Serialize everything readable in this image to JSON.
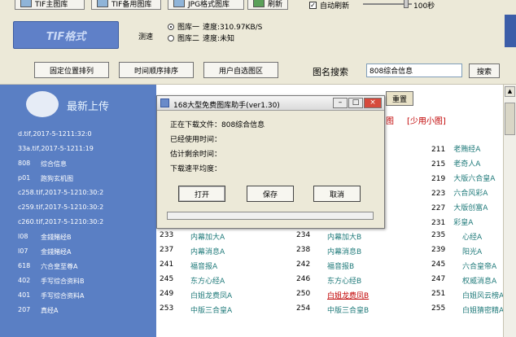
{
  "toolbar": {
    "tif_main": "TIF主图库",
    "tif_backup": "TIF备用图库",
    "jpg": "JPG格式图库",
    "refresh": "刷新",
    "auto_refresh": "自动刷新",
    "interval": "100秒"
  },
  "header": {
    "logo_text": "TIF格式",
    "speed_test_label": "测速",
    "lib1_label": "图库一",
    "lib1_speed": "速度:310.97KB/S",
    "lib2_label": "图库二",
    "lib2_speed": "速度:未知"
  },
  "buttons": {
    "fixed_order": "固定位置排列",
    "time_order": "时间顺序排序",
    "user_custom": "用户自选图区",
    "search_label": "图名搜索",
    "search_value": "808综合信息",
    "search_btn": "搜索"
  },
  "left": {
    "title": "最新上传",
    "items": [
      {
        "code": "d.tif,2017-5-1211:32:0",
        "name": ""
      },
      {
        "code": "33a.tif,2017-5-1211:19",
        "name": ""
      },
      {
        "code": "808",
        "name": "综合信息"
      },
      {
        "code": "p01",
        "name": "跑狗玄机图"
      },
      {
        "code": "c258.tif,2017-5-1210:30:2",
        "name": ""
      },
      {
        "code": "c259.tif,2017-5-1210:30:2",
        "name": ""
      },
      {
        "code": "c260.tif,2017-5-1210:30:2",
        "name": ""
      },
      {
        "code": "l08",
        "name": "金錢賭经B"
      },
      {
        "code": "l07",
        "name": "金錢賭经A"
      },
      {
        "code": "618",
        "name": "六合皇至尊A"
      },
      {
        "code": "402",
        "name": "手写综合资料B"
      },
      {
        "code": "401",
        "name": "手写综合资料A"
      },
      {
        "code": "207",
        "name": "真经A"
      }
    ]
  },
  "right": {
    "reset": "重置",
    "header_fragment": "图",
    "small_pic": "[少用小图]",
    "rows": [
      {
        "n1": "233",
        "t1": "内幕加大A",
        "n2": "234",
        "t2": "内幕加大B",
        "n3": "235",
        "t3": "心经A"
      },
      {
        "n1": "237",
        "t1": "内幕消息A",
        "n2": "238",
        "t2": "内幕消息B",
        "n3": "239",
        "t3": "阳光A"
      },
      {
        "n1": "241",
        "t1": "福音报A",
        "n2": "242",
        "t2": "福音报B",
        "n3": "245",
        "t3": "六合皇帝A"
      },
      {
        "n1": "245",
        "t1": "东方心经A",
        "n2": "246",
        "t2": "东方心经B",
        "n3": "247",
        "t3": "权威消息A"
      },
      {
        "n1": "249",
        "t1": "白姐龙费凤A",
        "n2": "250",
        "t2": "白姐龙费凤B",
        "n3": "251",
        "t3": "白姐风云榜A"
      },
      {
        "n1": "253",
        "t1": "中版三合皇A",
        "n2": "254",
        "t2": "中版三合皇B",
        "n3": "255",
        "t3": "白姐猜密精A"
      }
    ],
    "top_col": [
      {
        "n": "211",
        "t": "老贿经A"
      },
      {
        "n": "215",
        "t": "老奇人A"
      },
      {
        "n": "219",
        "t": "大版六合皇A"
      },
      {
        "n": "223",
        "t": "六合风彩A"
      },
      {
        "n": "227",
        "t": "大版创富A"
      },
      {
        "n": "231",
        "t": "彩皇A"
      }
    ]
  },
  "dialog": {
    "title": "168大型免费图库助手(ver1.30)",
    "downloading": "正在下载文件：808综合信息",
    "elapsed": "已经使用时间：",
    "remaining": "估计剩余时间：",
    "avg_speed": "下载速平均度：",
    "open_btn": "打开",
    "save_btn": "保存",
    "cancel_btn": "取消",
    "progress": 0
  }
}
